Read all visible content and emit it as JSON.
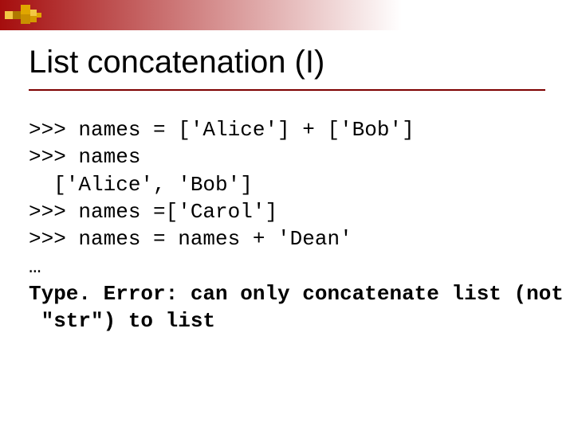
{
  "title": "List concatenation (I)",
  "code": [
    ">>> names = ['Alice'] + ['Bob']",
    ">>> names",
    "  ['Alice', 'Bob']",
    ">>> names =['Carol']",
    ">>> names = names + 'Dean'",
    "…",
    "Type. Error: can only concatenate list (not",
    " \"str\") to list"
  ]
}
